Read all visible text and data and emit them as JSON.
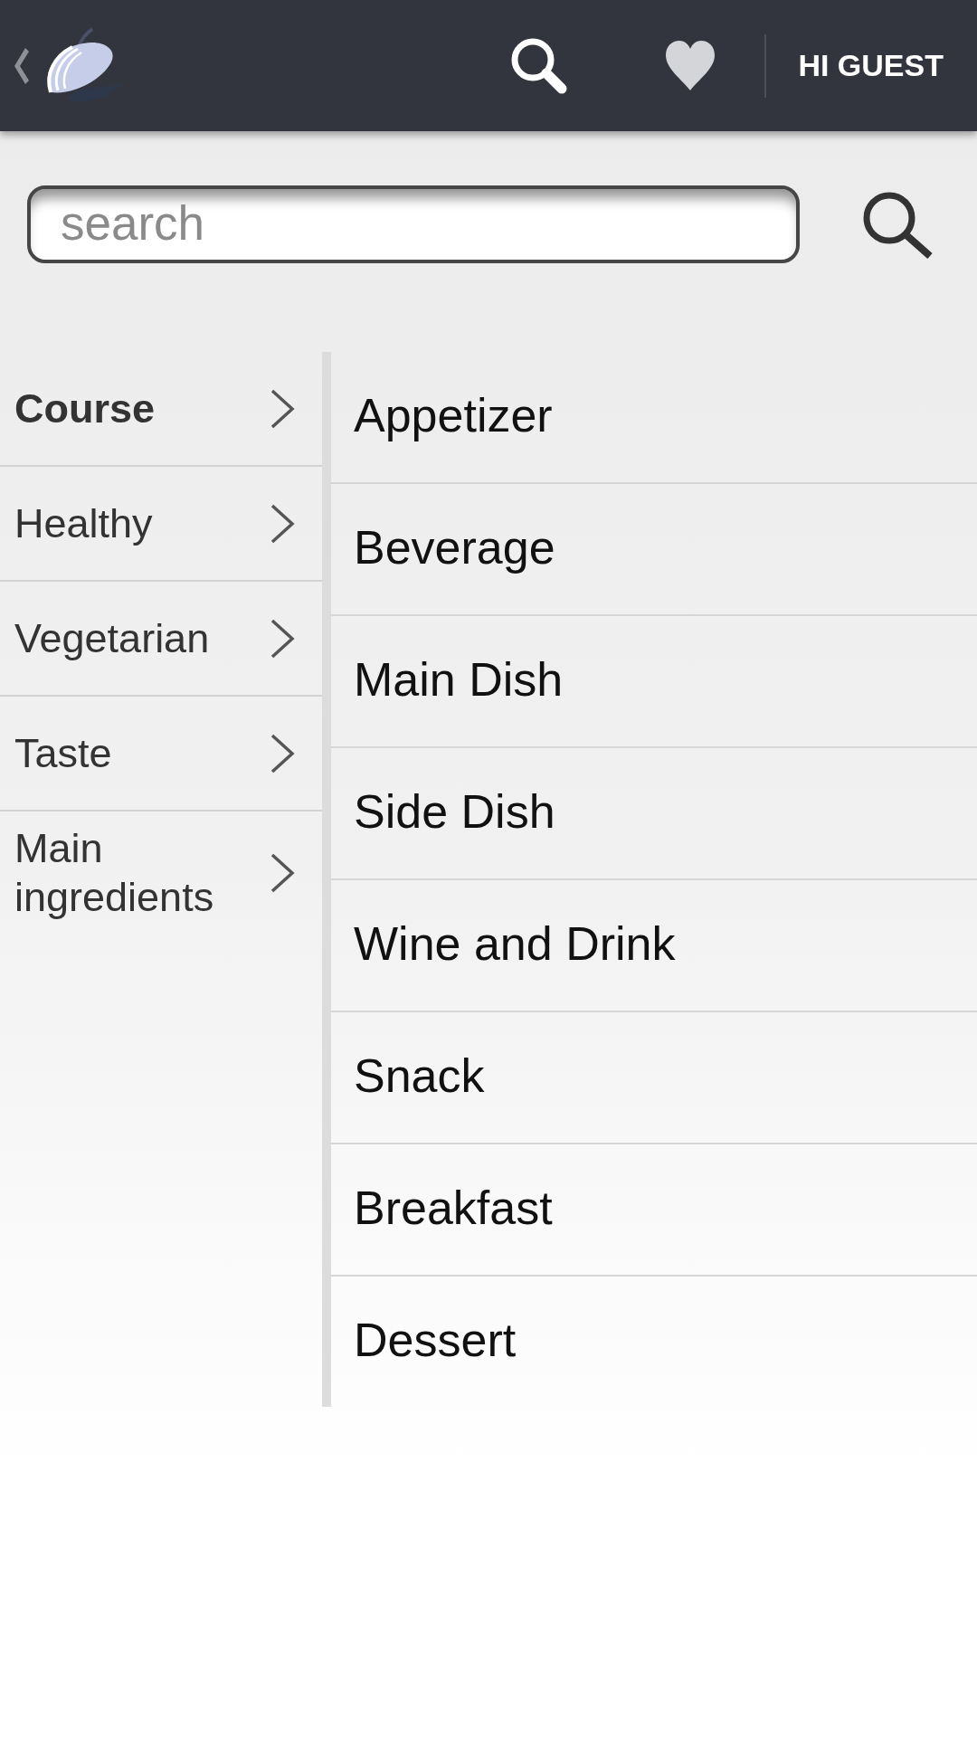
{
  "header": {
    "greeting": "HI GUEST"
  },
  "search": {
    "placeholder": "search"
  },
  "categories": [
    {
      "label": "Course",
      "selected": true
    },
    {
      "label": "Healthy",
      "selected": false
    },
    {
      "label": "Vegetarian",
      "selected": false
    },
    {
      "label": "Taste",
      "selected": false
    },
    {
      "label": "Main ingredients",
      "selected": false
    }
  ],
  "options": [
    "Appetizer",
    "Beverage",
    "Main Dish",
    "Side Dish",
    "Wine and Drink",
    "Snack",
    "Breakfast",
    "Dessert"
  ]
}
